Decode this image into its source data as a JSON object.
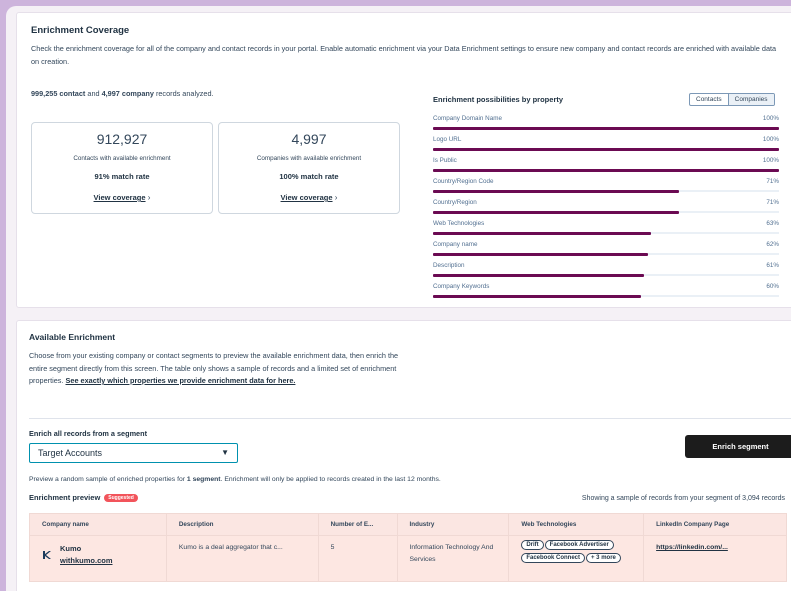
{
  "coverage": {
    "title": "Enrichment Coverage",
    "description": "Check the enrichment coverage for all of the company and contact records in your portal. Enable automatic enrichment via your Data Enrichment settings to ensure new company and contact records are enriched with available data on creation.",
    "contacts_count": "999,255 contact",
    "and_text": " and ",
    "companies_count": "4,997 company",
    "records_text": " records analyzed.",
    "contacts_box": {
      "number": "912,927",
      "label": "Contacts with available enrichment",
      "rate": "91% match rate",
      "link": "View coverage",
      "chevron": "›"
    },
    "companies_box": {
      "number": "4,997",
      "label": "Companies with available enrichment",
      "rate": "100% match rate",
      "link": "View coverage",
      "chevron": "›"
    },
    "possibilities_title": "Enrichment possibilities by property",
    "toggle": {
      "contacts": "Contacts",
      "companies": "Companies",
      "selected": "Companies"
    },
    "properties": [
      {
        "name": "Company Domain Name",
        "percent": "100%",
        "value": 1.0
      },
      {
        "name": "Logo URL",
        "percent": "100%",
        "value": 1.0
      },
      {
        "name": "Is Public",
        "percent": "100%",
        "value": 1.0
      },
      {
        "name": "Country/Region Code",
        "percent": "71%",
        "value": 0.71
      },
      {
        "name": "Country/Region",
        "percent": "71%",
        "value": 0.71
      },
      {
        "name": "Web Technologies",
        "percent": "63%",
        "value": 0.63
      },
      {
        "name": "Company name",
        "percent": "62%",
        "value": 0.62
      },
      {
        "name": "Description",
        "percent": "61%",
        "value": 0.61
      },
      {
        "name": "Company Keywords",
        "percent": "60%",
        "value": 0.6
      }
    ],
    "accent_color": "#6b0a52"
  },
  "available": {
    "title": "Available Enrichment",
    "description_1": "Choose from your existing company or contact segments to preview the available enrichment data, then enrich the entire segment directly from this screen. The table only shows a sample of records and a limited set of enrichment properties. ",
    "description_link": "See exactly which properties we provide enrichment data for here.",
    "segment_label": "Enrich all records from a segment",
    "segment_value": "Target Accounts",
    "enrich_button": "Enrich segment",
    "preview_note_1": "Preview a random sample of enriched properties for ",
    "preview_note_bold": "1 segment",
    "preview_note_2": ". Enrichment will only be applied to records created in the last 12 months.",
    "preview_title": "Enrichment preview",
    "suggested_badge": "Suggested",
    "sample_text": "Showing a sample of records from your segment of 3,094 records",
    "table": {
      "columns": [
        "Company name",
        "Description",
        "Number of E...",
        "Industry",
        "Web Technologies",
        "LinkedIn Company Page"
      ],
      "rows": [
        {
          "company": "Kumo",
          "domain": "withkumo.com",
          "description": "Kumo is a deal aggregator that c...",
          "employees": "5",
          "industry": "Information Technology And Services",
          "tech": [
            "Drift",
            "Facebook Advertiser",
            "Facebook Connect",
            "+ 3 more"
          ],
          "linkedin": "https://linkedin.com/..."
        }
      ]
    }
  }
}
